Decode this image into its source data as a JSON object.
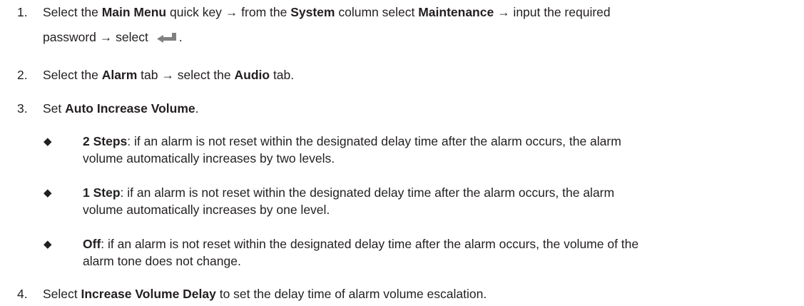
{
  "steps": [
    {
      "number": "1.",
      "parts": [
        "Select the ",
        "Main Menu",
        " quick key → from the ",
        "System",
        " column select ",
        "Maintenance",
        " → input the required"
      ],
      "line2_prefix": "password → select ",
      "line2_suffix": "."
    },
    {
      "number": "2.",
      "parts": [
        "Select the ",
        "Alarm",
        " tab → select the ",
        "Audio",
        " tab."
      ]
    },
    {
      "number": "3.",
      "parts": [
        "Set ",
        "Auto Increase Volume",
        "."
      ]
    },
    {
      "number": "4.",
      "parts": [
        "Select ",
        "Increase Volume Delay",
        " to set the delay time of alarm volume escalation."
      ]
    }
  ],
  "bullets": [
    {
      "symbol": "◆",
      "term": "2 Steps",
      "line1": ": if an alarm is not reset within the designated delay time after the alarm occurs, the alarm",
      "line2": "volume automatically increases by two levels."
    },
    {
      "symbol": "◆",
      "term": "1 Step",
      "line1": ": if an alarm is not reset within the designated delay time after the alarm occurs, the alarm",
      "line2": "volume automatically increases by one level."
    },
    {
      "symbol": "◆",
      "term": "Off",
      "line1": ": if an alarm is not reset within the designated delay time after the alarm occurs, the volume of the",
      "line2": "alarm tone does not change."
    }
  ],
  "icons": {
    "enter": "enter-arrow-icon"
  },
  "colors": {
    "text": "#231f20",
    "icon": "#808080"
  }
}
